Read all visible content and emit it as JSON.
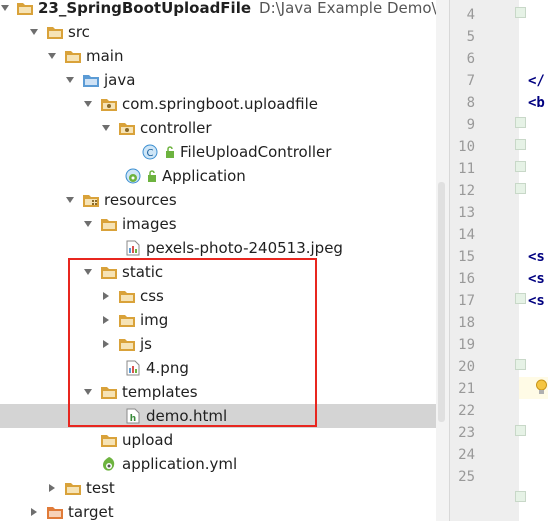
{
  "project_tree": {
    "project": {
      "name": "23_SpringBootUploadFile",
      "path": "D:\\Java Example Demo\\Spri"
    },
    "nodes": {
      "src": "src",
      "main": "main",
      "java": "java",
      "package": "com.springboot.uploadfile",
      "controller": "controller",
      "file_upload_controller": "FileUploadController",
      "application": "Application",
      "resources": "resources",
      "images": "images",
      "pexels": "pexels-photo-240513.jpeg",
      "static": "static",
      "css": "css",
      "img": "img",
      "js": "js",
      "png4": "4.png",
      "templates": "templates",
      "demo_html": "demo.html",
      "upload": "upload",
      "application_yml": "application.yml",
      "test": "test",
      "target": "target"
    },
    "selected": "demo.html"
  },
  "editor": {
    "line_numbers": [
      "4",
      "5",
      "6",
      "7",
      "8",
      "9",
      "10",
      "11",
      "12",
      "13",
      "14",
      "15",
      "16",
      "17",
      "18",
      "19",
      "20",
      "21",
      "22",
      "23",
      "24",
      "25"
    ],
    "current_line": "21",
    "code_fragments": {
      "l7": "</",
      "l8": "<b",
      "l15": "<s",
      "l16": "<s",
      "l17": "<s"
    }
  },
  "colors": {
    "highlight_box": "#e8261f",
    "selection": "#d4d4d4",
    "folder": "#d9a23a",
    "source_folder": "#5b9bd5",
    "spring_green": "#6db33f"
  }
}
